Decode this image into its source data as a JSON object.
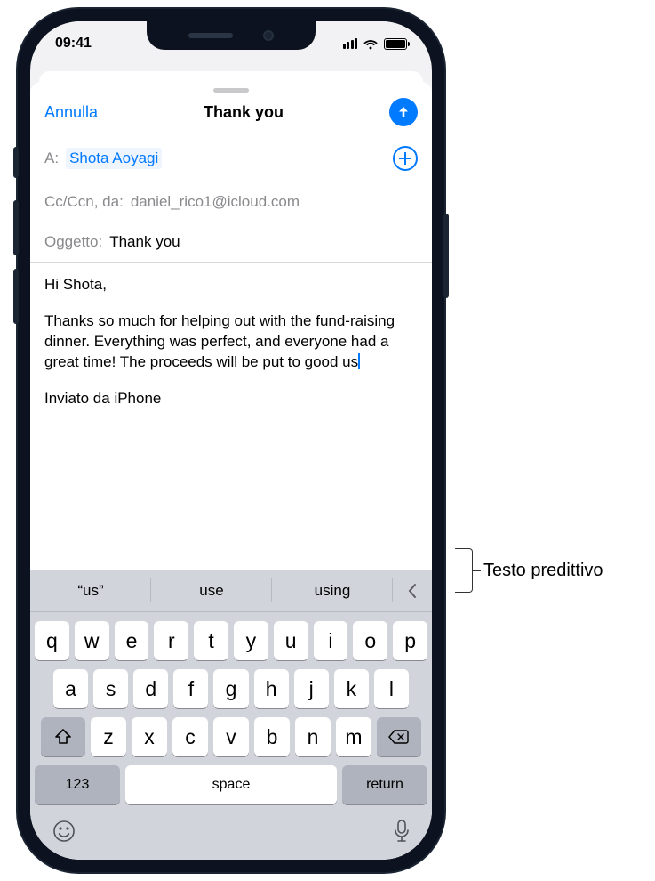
{
  "status": {
    "time": "09:41"
  },
  "nav": {
    "cancel": "Annulla",
    "title": "Thank you"
  },
  "fields": {
    "to_label": "A:",
    "to_recipient": "Shota Aoyagi",
    "cc_label": "Cc/Ccn, da:",
    "cc_value": "daniel_rico1@icloud.com",
    "subject_label": "Oggetto:",
    "subject_value": "Thank you"
  },
  "body": {
    "greeting": "Hi Shota,",
    "paragraph": "Thanks so much for helping out with the fund-raising dinner. Everything was perfect, and everyone had a great time! The proceeds will be put to good us",
    "signature": "Inviato da iPhone"
  },
  "predictive": {
    "s1": "“us”",
    "s2": "use",
    "s3": "using"
  },
  "keys": {
    "r1": [
      "q",
      "w",
      "e",
      "r",
      "t",
      "y",
      "u",
      "i",
      "o",
      "p"
    ],
    "r2": [
      "a",
      "s",
      "d",
      "f",
      "g",
      "h",
      "j",
      "k",
      "l"
    ],
    "r3": [
      "z",
      "x",
      "c",
      "v",
      "b",
      "n",
      "m"
    ],
    "k123": "123",
    "space": "space",
    "return": "return"
  },
  "callout": {
    "label": "Testo predittivo"
  }
}
